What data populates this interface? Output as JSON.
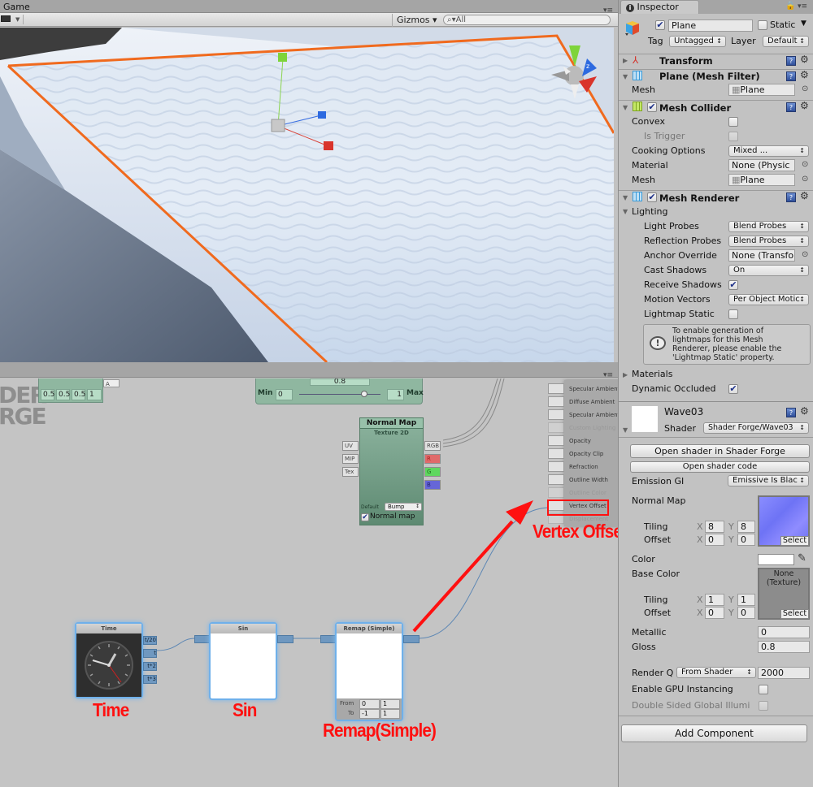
{
  "game": {
    "tab_label": "Game",
    "toolbar": {
      "display_icon": "display-icon",
      "gizmos_label": "Gizmos ▾",
      "search_placeholder": "All"
    },
    "panel_menu_icon": "▾≡",
    "scene": {
      "selection_outline_color": "#f06a1e",
      "axis_colors": {
        "x": "#d9342b",
        "y": "#7ed43a",
        "z": "#2d6ae0"
      },
      "orientation_gizmo": "scene-orientation-gizmo"
    }
  },
  "node_editor": {
    "panel_menu_icon": "▾≡",
    "logo_lines": [
      "DER",
      "RGE"
    ],
    "vector4_node": {
      "values": [
        "0.5",
        "0.5",
        "0.5",
        "1"
      ],
      "output_port": "A"
    },
    "slider_node": {
      "value": "0.8",
      "min_label": "Min",
      "min_value": "0",
      "max_label": "Max",
      "max_value": "1",
      "slider_fraction": 0.8
    },
    "normal_map_node": {
      "title": "Normal Map",
      "subtitle": "Texture 2D",
      "inputs": [
        "UV",
        "MIP",
        "Tex"
      ],
      "outputs": [
        "RGB",
        "R",
        "G",
        "B"
      ],
      "output_colors": [
        "#e3e3e3",
        "#e06a6a",
        "#5fd85f",
        "#6666d8"
      ],
      "default_label": "Default",
      "default_value": "Bump",
      "normal_map_checkbox_label": "Normal map",
      "normal_map_checked": true
    },
    "main_node_inputs": [
      {
        "label": "Specular Ambient",
        "enabled": true
      },
      {
        "label": "Diffuse Ambient",
        "enabled": true
      },
      {
        "label": "Specular Ambient",
        "enabled": true
      },
      {
        "label": "Custom Lighting",
        "enabled": false
      },
      {
        "label": "Opacity",
        "enabled": true
      },
      {
        "label": "Opacity Clip",
        "enabled": true
      },
      {
        "label": "Refraction",
        "enabled": true
      },
      {
        "label": "Outline Width",
        "enabled": true
      },
      {
        "label": "Outline Color",
        "enabled": false
      },
      {
        "label": "Vertex Offset",
        "enabled": true,
        "highlighted": true
      },
      {
        "label": "Displacement",
        "enabled": false
      }
    ],
    "time_node": {
      "title": "Time",
      "outputs": [
        "t/20",
        "t",
        "t*2",
        "t*3"
      ]
    },
    "sin_node": {
      "title": "Sin"
    },
    "remap_node": {
      "title": "Remap (Simple)",
      "from_label": "From",
      "from_values": [
        "0",
        "1"
      ],
      "to_label": "To",
      "to_values": [
        "-1",
        "1"
      ]
    },
    "annotations": {
      "time": "Time",
      "sin": "Sin",
      "remap": "Remap(Simple)",
      "vertex_offset": "Vertex Offset",
      "color": "#ff1010"
    }
  },
  "inspector": {
    "tab_label": "Inspector",
    "tab_icon": "info-icon",
    "lock_icon": "lock-icon",
    "menu_icon": "▾≡",
    "object": {
      "active": true,
      "name": "Plane",
      "static_label": "Static",
      "static_checked": false,
      "tag_label": "Tag",
      "tag_value": "Untagged",
      "layer_label": "Layer",
      "layer_value": "Default"
    },
    "transform": {
      "title": "Transform"
    },
    "mesh_filter": {
      "title": "Plane (Mesh Filter)",
      "mesh_label": "Mesh",
      "mesh_value": "Plane"
    },
    "mesh_collider": {
      "title": "Mesh Collider",
      "enabled": true,
      "convex_label": "Convex",
      "convex": false,
      "is_trigger_label": "Is Trigger",
      "is_trigger": false,
      "cooking_label": "Cooking Options",
      "cooking_value": "Mixed ...",
      "material_label": "Material",
      "material_value": "None (Physic",
      "mesh_label": "Mesh",
      "mesh_value": "Plane"
    },
    "mesh_renderer": {
      "title": "Mesh Renderer",
      "enabled": true,
      "lighting_label": "Lighting",
      "light_probes_label": "Light Probes",
      "light_probes_value": "Blend Probes",
      "reflection_probes_label": "Reflection Probes",
      "reflection_probes_value": "Blend Probes",
      "anchor_label": "Anchor Override",
      "anchor_value": "None (Transfo",
      "cast_shadows_label": "Cast Shadows",
      "cast_shadows_value": "On",
      "receive_shadows_label": "Receive Shadows",
      "receive_shadows": true,
      "motion_vectors_label": "Motion Vectors",
      "motion_vectors_value": "Per Object Motic",
      "lightmap_static_label": "Lightmap Static",
      "lightmap_static": false,
      "help_lines": [
        "To enable generation of",
        "lightmaps for this Mesh",
        "Renderer, please enable the",
        "'Lightmap Static' property."
      ],
      "materials_label": "Materials",
      "dynamic_occluded_label": "Dynamic Occluded",
      "dynamic_occluded": true
    },
    "material": {
      "name": "Wave03",
      "shader_label": "Shader",
      "shader_value": "Shader Forge/Wave03",
      "open_sf_button": "Open shader in Shader Forge",
      "open_code_button": "Open shader code",
      "emission_gi_label": "Emission GI",
      "emission_gi_value": "Emissive Is Blac",
      "normal_map_label": "Normal Map",
      "normal_tiling_label": "Tiling",
      "normal_offset_label": "Offset",
      "normal_tiling": {
        "x": "8",
        "y": "8"
      },
      "normal_offset": {
        "x": "0",
        "y": "0"
      },
      "select_label": "Select",
      "color_label": "Color",
      "color_value": "#ffffff",
      "base_color_label": "Base Color",
      "base_color_texture": "None\n(Texture)",
      "base_texture_line1": "None",
      "base_texture_line2": "(Texture)",
      "base_tiling_label": "Tiling",
      "base_offset_label": "Offset",
      "base_tiling": {
        "x": "1",
        "y": "1"
      },
      "base_offset": {
        "x": "0",
        "y": "0"
      },
      "x_label": "X",
      "y_label": "Y",
      "metallic_label": "Metallic",
      "metallic_value": "0",
      "gloss_label": "Gloss",
      "gloss_value": "0.8",
      "render_queue_label": "Render Q",
      "render_queue_mode": "From Shader",
      "render_queue_value": "2000",
      "gpu_instancing_label": "Enable GPU Instancing",
      "gpu_instancing": false,
      "double_sided_label": "Double Sided Global Illumi",
      "double_sided": false
    },
    "add_component_button": "Add Component"
  }
}
